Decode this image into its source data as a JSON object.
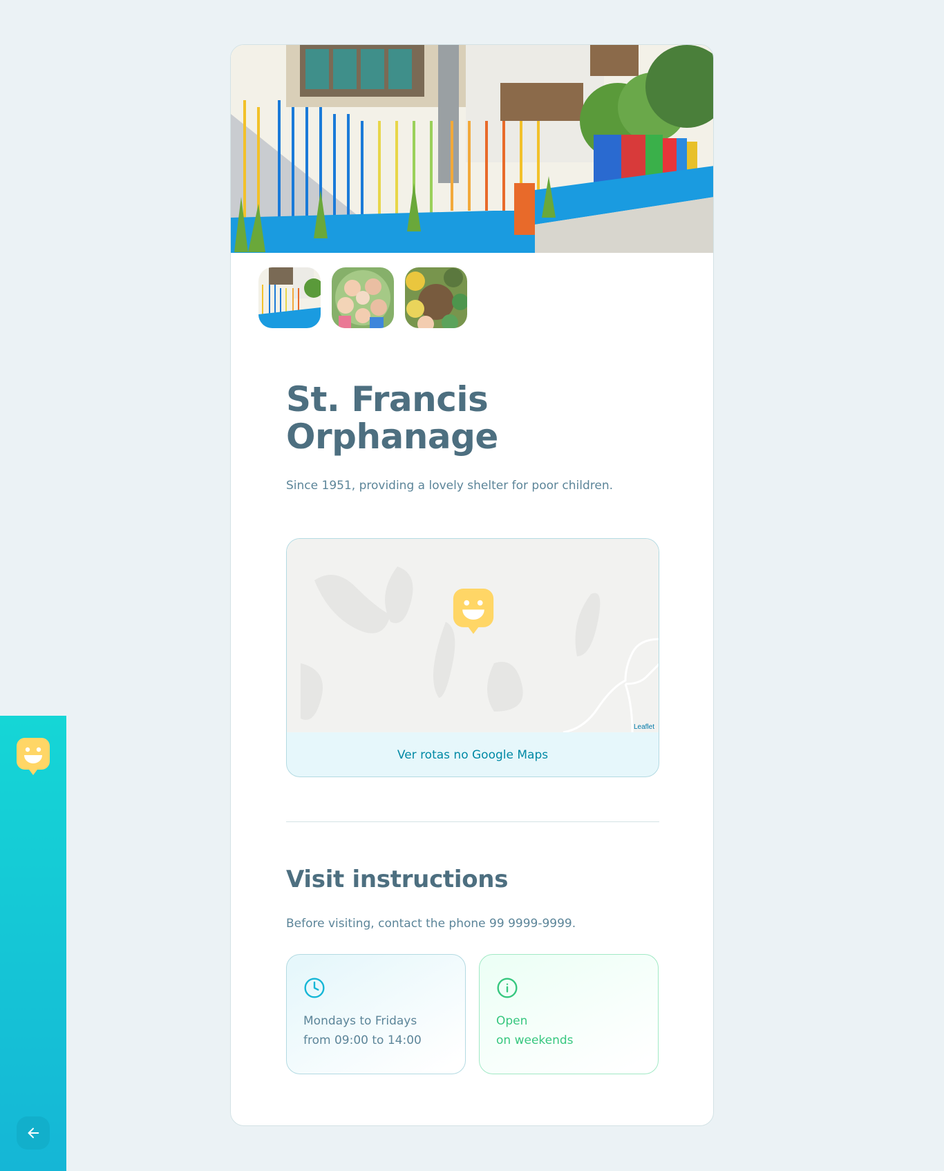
{
  "sidebar": {
    "logo_icon": "happy-pin-icon",
    "back_icon": "arrow-left-icon"
  },
  "orphanage": {
    "name": "St. Francis Orphanage",
    "description": "Since 1951, providing a lovely shelter for poor children.",
    "thumbnails": [
      {
        "name": "thumbnail-building",
        "active": true
      },
      {
        "name": "thumbnail-children",
        "active": false
      },
      {
        "name": "thumbnail-garden",
        "active": false
      }
    ]
  },
  "map": {
    "marker_icon": "happy-pin-icon",
    "attribution": "Leaflet",
    "directions_link": "Ver rotas no Google Maps"
  },
  "visit": {
    "title": "Visit instructions",
    "instructions": "Before visiting, contact the phone 99 9999-9999.",
    "hours_icon": "clock-icon",
    "hours_line1": "Mondays to Fridays",
    "hours_line2": "from 09:00 to 14:00",
    "weekend_icon": "info-icon",
    "weekend_line1": "Open",
    "weekend_line2": "on weekends"
  },
  "colors": {
    "sidebar_gradient_start": "#15d6d6",
    "sidebar_gradient_end": "#15b6d6",
    "marker": "#ffd666",
    "title": "#4d6f80",
    "link": "#0089a5",
    "open_green": "#37c77f"
  }
}
